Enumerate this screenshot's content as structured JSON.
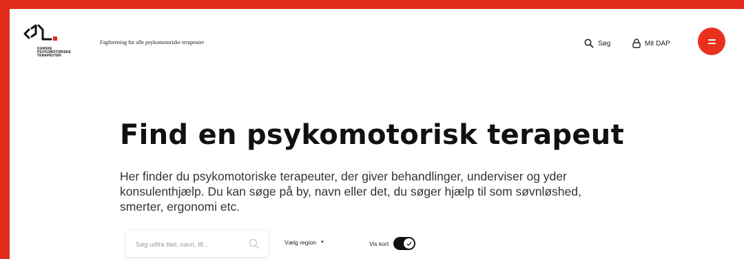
{
  "header": {
    "logo_lines": [
      "DANSKE",
      "PSYKOMOTORISKE",
      "TERAPEUTER"
    ],
    "tagline": "Fagforening for alle psykomotoriske terapeuter",
    "search_label": "Søg",
    "mydap_label": "Mit DAP",
    "search_icon": "search-icon",
    "lock_icon": "lock-icon",
    "menu_icon": "hamburger-menu-icon",
    "accent_color": "#e8321f"
  },
  "hero": {
    "title": "Find en psykomotorisk terapeut",
    "description": "Her finder du psykomotoriske terapeuter, der giver behandlinger, underviser og yder konsulenthjælp. Du kan søge på by, navn eller det, du søger hjælp til som søvnløshed, smerter, ergonomi etc."
  },
  "filters": {
    "search_placeholder": "Søg udfra titel, navn, tlf...",
    "search_value": "",
    "region_label": "Vælg region",
    "map_toggle_label": "Vis kort",
    "map_toggle_on": true
  }
}
